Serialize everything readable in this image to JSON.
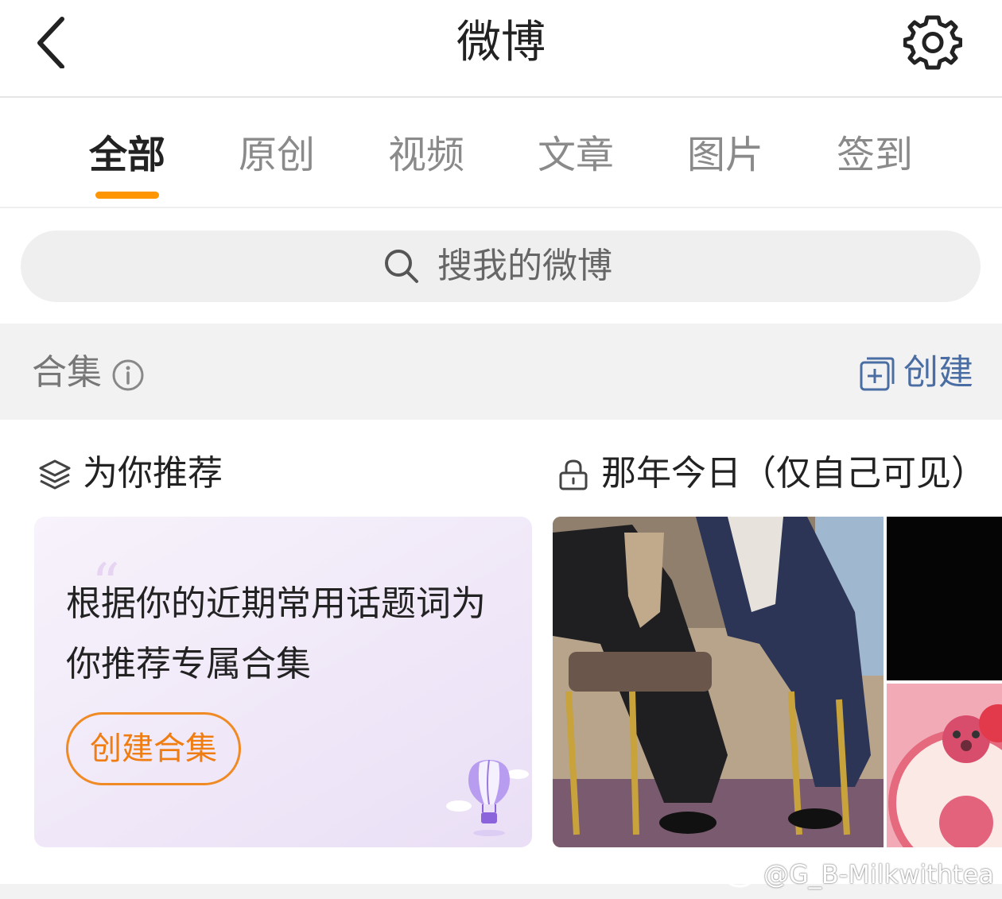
{
  "header": {
    "title": "微博",
    "back_icon": "chevron-left-icon",
    "settings_icon": "gear-icon"
  },
  "tabs": [
    {
      "label": "全部",
      "active": true
    },
    {
      "label": "原创",
      "active": false
    },
    {
      "label": "视频",
      "active": false
    },
    {
      "label": "文章",
      "active": false
    },
    {
      "label": "图片",
      "active": false
    },
    {
      "label": "签到",
      "active": false
    }
  ],
  "search": {
    "placeholder": "搜我的微博",
    "icon": "search-icon"
  },
  "collections": {
    "title": "合集",
    "info_icon": "info-icon",
    "create_label": "创建",
    "create_icon": "add-square-icon"
  },
  "recommend": {
    "title": "为你推荐",
    "icon": "layers-icon",
    "description": "根据你的近期常用话题词为你推荐专属合集",
    "button_label": "创建合集"
  },
  "memory": {
    "title": "那年今日（仅自己可见）",
    "icon": "lock-icon"
  },
  "watermark": {
    "text": "@G_B-Milkwithtea",
    "icon": "weibo-logo-icon"
  },
  "colors": {
    "accent": "#ff9500",
    "link": "#4a6da3",
    "button_orange": "#f07d12"
  }
}
